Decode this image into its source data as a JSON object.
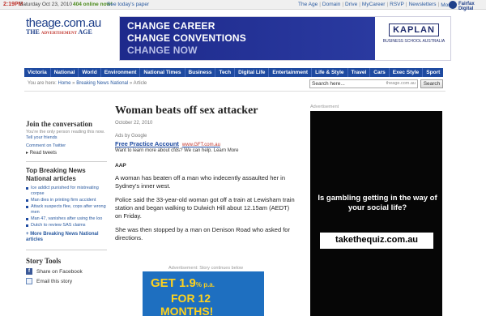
{
  "topbar": {
    "time": "2:19PM",
    "date": "Saturday Oct 23, 2010",
    "online": "404 online now!",
    "todays_paper": "See today's paper",
    "links": [
      "The Age",
      "Domain",
      "Drive",
      "MyCareer",
      "RSVP",
      "Newsletters",
      "More"
    ],
    "more_arrow": "▾",
    "fairfax": "Fairfax Digital"
  },
  "logo": {
    "main": "theage.com.au",
    "sub_prefix": "THE",
    "sub_small": "ADVERTISEMENT",
    "sub_suffix": "AGE"
  },
  "banner": {
    "line1": "CHANGE CAREER",
    "line2": "CHANGE CONVENTIONS",
    "line3": "CHANGE NOW",
    "brand": "KAPLAN",
    "school": "BUSINESS SCHOOL AUSTRALIA"
  },
  "nav": [
    "Victoria",
    "National",
    "World",
    "Environment",
    "National Times",
    "Business",
    "Tech",
    "Digital Life",
    "Entertainment",
    "Life & Style",
    "Travel",
    "Cars",
    "Exec Style",
    "Sport"
  ],
  "crumbs": {
    "prefix": "You are here:",
    "home": "Home",
    "section": "Breaking News National",
    "current": "Article",
    "sep": "»"
  },
  "search": {
    "value": "Search here...",
    "domain": "theage.com.au",
    "button": "Search"
  },
  "left": {
    "join_title": "Join the conversation",
    "join_sub": "You're the only person reading this now.",
    "tell_friends": "Tell your friends",
    "comment_twitter": "Comment on Twitter",
    "read_tweets": "Read tweets",
    "top_title": "Top Breaking News National articles",
    "top_items": [
      "Ice addict punished for mistreating corpse",
      "Man dies in printing firm accident",
      "Attack suspects flee, cops after wrong men",
      "Man 47, vanishes after using the loo",
      "Dutch to review SAS claims"
    ],
    "more_link": "More Breaking News National articles",
    "story_tools": "Story Tools",
    "share_fb": "Share on Facebook",
    "email_story": "Email this story"
  },
  "article": {
    "headline": "Woman beats off sex attacker",
    "date": "October 22, 2010",
    "ads_by": "Ads by Google",
    "ad_title": "Free Practice Account",
    "ad_url": "www.GFT.com.au",
    "ad_desc": "Want to learn more about cfds? We can help. Learn More",
    "source": "AAP",
    "paragraphs": [
      "A woman has beaten off a man who indecently assaulted her in Sydney's inner west.",
      "Police said the 33-year-old woman got off a train at Lewisham train station and began walking to Dulwich Hill about 12.15am (AEDT) on Friday.",
      "She was then stopped by a man on Denison Road who asked for directions."
    ],
    "ad_notice": "Advertisement: Story continues below"
  },
  "promo": {
    "line1_main": "GET 1.9",
    "line1_small": "% p.a.",
    "line2": "FOR 12",
    "line3": "MONTHS!"
  },
  "right_ad": {
    "label": "Advertisement",
    "question": "Is gambling getting in the way of your social life?",
    "url": "takethequiz.com.au"
  }
}
